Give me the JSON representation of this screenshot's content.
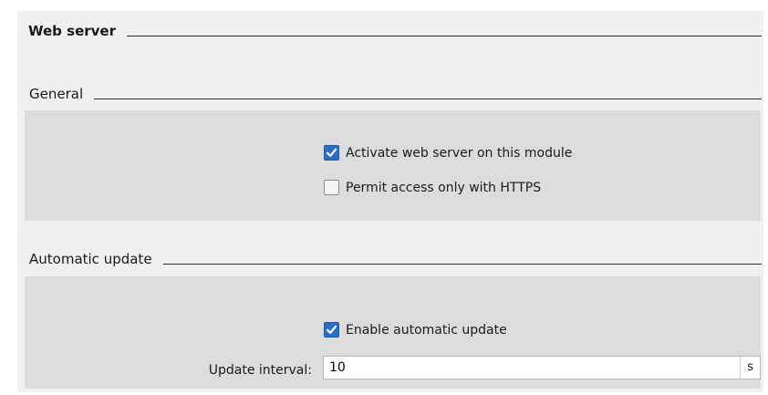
{
  "panel": {
    "title": "Web server"
  },
  "general": {
    "title": "General",
    "activate_web_server": {
      "label": "Activate web server on this module",
      "checked": true
    },
    "https_only": {
      "label": "Permit access only with HTTPS",
      "checked": false
    }
  },
  "automatic_update": {
    "title": "Automatic update",
    "enable_update": {
      "label": "Enable automatic update",
      "checked": true
    },
    "update_interval": {
      "label": "Update interval:",
      "value": "10",
      "unit": "s"
    }
  },
  "colors": {
    "panel_bg": "#f0f0f0",
    "group_bg": "#dcdcdc",
    "checkbox_checked": "#2a6fc4"
  }
}
